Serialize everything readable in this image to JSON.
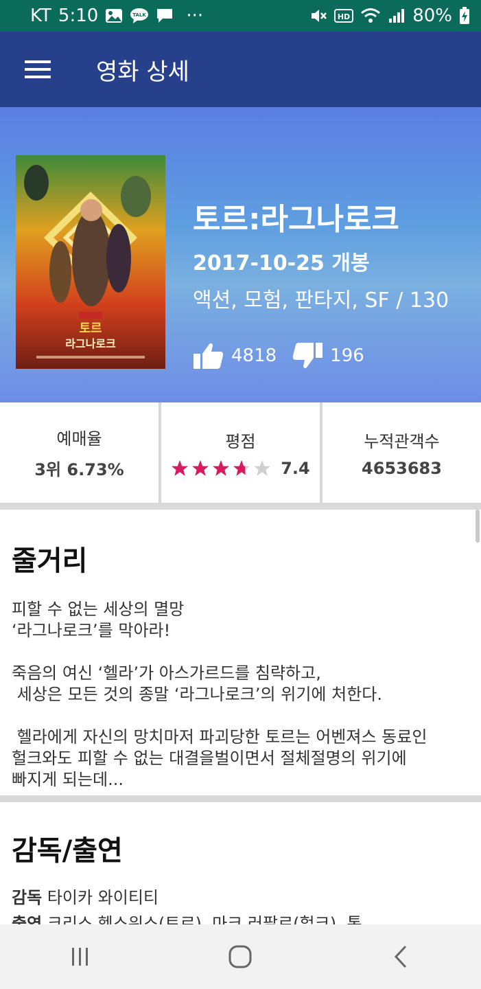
{
  "status_bar": {
    "carrier": "KT",
    "time": "5:10",
    "notification_icons": [
      "gallery-icon",
      "kakaotalk-icon",
      "message-icon"
    ],
    "more": "···",
    "system_icons": [
      "mute-icon",
      "hd-icon",
      "wifi-icon",
      "signal-icon"
    ],
    "battery": "80%"
  },
  "app_bar": {
    "title": "영화 상세",
    "menu_icon": "hamburger-menu-icon"
  },
  "movie": {
    "title": "토르:라그나로크",
    "release": "2017-10-25 개봉",
    "genre": "액션, 모험, 판타지, SF / 130",
    "likes": "4818",
    "dislikes": "196",
    "poster_text": "토르 라그나로크"
  },
  "stats": {
    "booking_label": "예매율",
    "booking_value": "3위 6.73%",
    "rating_label": "평점",
    "rating_value": "7.4",
    "rating_stars": 3.7,
    "rating_max_stars": 5,
    "audience_label": "누적관객수",
    "audience_value": "4653683"
  },
  "synopsis": {
    "title": "줄거리",
    "text": "피할 수 없는 세상의 멸망\n‘라그나로크’를 막아라!\n\n죽음의 여신 ‘헬라’가 아스가르드를 침략하고,\n 세상은 모든 것의 종말 ‘라그나로크’의 위기에 처한다.\n\n 헬라에게 자신의 망치마저 파괴당한 토르는 어벤져스 동료인\n헐크와도 피할 수 없는 대결을벌이면서 절체절명의 위기에\n빠지게 되는데..."
  },
  "credits": {
    "title": "감독/출연",
    "director_label": "감독",
    "director": "타이카 와이티티",
    "cast_label": "출연",
    "cast": "크리스 헴스워스(토르), 마크 러팔로(헐크), 톰"
  },
  "colors": {
    "status_bar": "#0b6b5a",
    "app_bar": "#27408b",
    "star_filled": "#d81b60",
    "star_empty": "#d0d0d0"
  }
}
